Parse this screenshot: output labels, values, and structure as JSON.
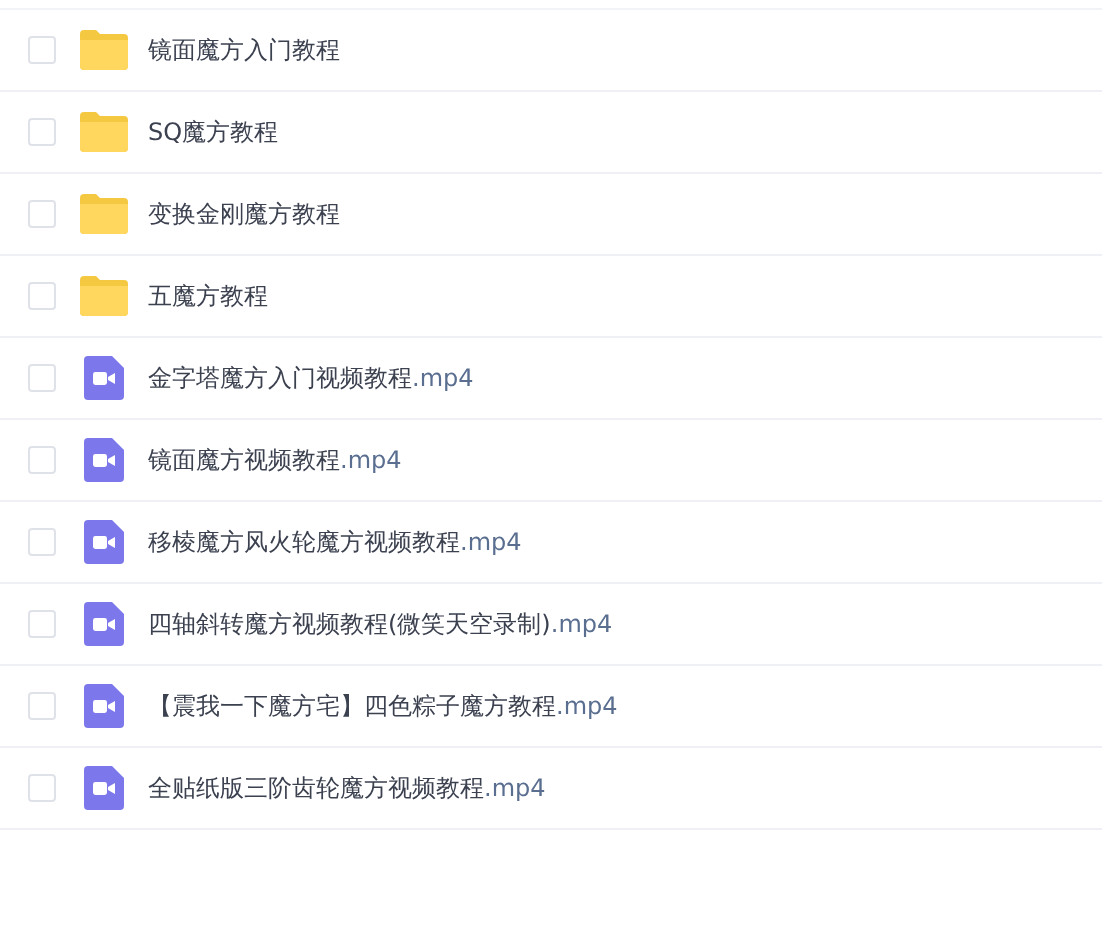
{
  "files": [
    {
      "kind": "folder",
      "name": "镜面魔方入门教程",
      "checked": false
    },
    {
      "kind": "folder",
      "name": "SQ魔方教程",
      "checked": false
    },
    {
      "kind": "folder",
      "name": "变换金刚魔方教程",
      "checked": false
    },
    {
      "kind": "folder",
      "name": "五魔方教程",
      "checked": false
    },
    {
      "kind": "video",
      "name": "金字塔魔方入门视频教程",
      "ext": ".mp4",
      "checked": false
    },
    {
      "kind": "video",
      "name": "镜面魔方视频教程",
      "ext": ".mp4",
      "checked": false
    },
    {
      "kind": "video",
      "name": "移棱魔方风火轮魔方视频教程",
      "ext": ".mp4",
      "checked": false
    },
    {
      "kind": "video",
      "name": "四轴斜转魔方视频教程(微笑天空录制)",
      "ext": ".mp4",
      "checked": false
    },
    {
      "kind": "video",
      "name": "【震我一下魔方宅】四色粽子魔方教程",
      "ext": ".mp4",
      "checked": false
    },
    {
      "kind": "video",
      "name": "全贴纸版三阶齿轮魔方视频教程",
      "ext": ".mp4",
      "checked": false
    }
  ]
}
